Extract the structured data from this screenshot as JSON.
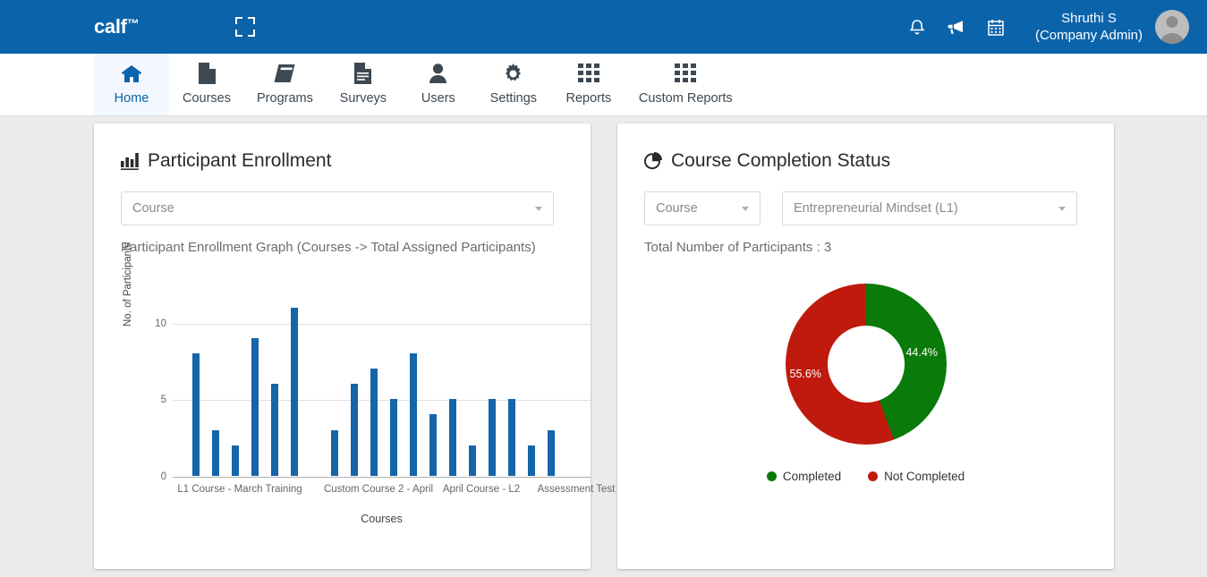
{
  "header": {
    "brand": "calf",
    "brand_tm": "™",
    "expand_icon": "fullscreen-icon",
    "icons": [
      {
        "name": "notifications-icon",
        "glyph": "🔔"
      },
      {
        "name": "announcements-icon",
        "glyph": "📢"
      },
      {
        "name": "calendar-icon",
        "glyph": "📅"
      }
    ],
    "user_name": "Shruthi S",
    "user_role": "(Company Admin)",
    "bg_color": "#0b63aa"
  },
  "nav": {
    "items": [
      {
        "label": "Home",
        "icon": "home-icon",
        "active": true
      },
      {
        "label": "Courses",
        "icon": "file-icon",
        "active": false
      },
      {
        "label": "Programs",
        "icon": "book-icon",
        "active": false
      },
      {
        "label": "Surveys",
        "icon": "document-lines-icon",
        "active": false
      },
      {
        "label": "Users",
        "icon": "user-icon",
        "active": false
      },
      {
        "label": "Settings",
        "icon": "gear-icon",
        "active": false
      },
      {
        "label": "Reports",
        "icon": "grid-icon",
        "active": false
      },
      {
        "label": "Custom Reports",
        "icon": "grid-icon",
        "active": false
      }
    ],
    "active_color": "#0b63aa"
  },
  "enrollment_card": {
    "title": "Participant Enrollment",
    "title_icon": "bar-chart-icon",
    "course_select_value": "Course",
    "description": "Participant Enrollment Graph (Courses -> Total Assigned Participants)"
  },
  "completion_card": {
    "title": "Course Completion Status",
    "title_icon": "pie-chart-icon",
    "course_select_value": "Course",
    "course_name_select_value": "Entrepreneurial Mindset (L1)",
    "total_participants_text": "Total Number of Participants : 3"
  },
  "chart_data": [
    {
      "type": "bar",
      "title": "Participant Enrollment Graph (Courses -> Total Assigned Participants)",
      "xlabel": "Courses",
      "ylabel": "No. of Participants",
      "ylim": [
        0,
        11.5
      ],
      "yticks": [
        0,
        5,
        10
      ],
      "grid": true,
      "bar_color": "#1565a8",
      "categories": [
        "L1 Course - March Training",
        "",
        "",
        "",
        "",
        "",
        "Custom Course 2 - April",
        "",
        "",
        "",
        "",
        "",
        "April Course - L2",
        "",
        "",
        "",
        "",
        "Assessment Test",
        ""
      ],
      "xtick_labels": [
        "L1 Course - March Training",
        "Custom Course 2 - April",
        "April Course - L2",
        "Assessment Test"
      ],
      "values": [
        8,
        3,
        2,
        9,
        6,
        11,
        3,
        6,
        7,
        5,
        8,
        4,
        5,
        2,
        5,
        5,
        2,
        3
      ],
      "bar_positions": [
        22,
        44,
        66,
        88,
        110,
        132,
        177,
        199,
        221,
        243,
        265,
        287,
        309,
        331,
        353,
        375,
        397,
        419
      ],
      "xtick_positions": [
        75,
        230,
        345,
        451
      ]
    },
    {
      "type": "pie",
      "variant": "donut",
      "title": "Course Completion Status",
      "labels": [
        "Completed",
        "Not Completed"
      ],
      "values": [
        44.4,
        55.6
      ],
      "value_labels": [
        "44.4%",
        "55.6%"
      ],
      "colors": [
        "#0a7a0a",
        "#bf1a0d"
      ],
      "legend_position": "bottom",
      "total_participants": 3
    }
  ]
}
